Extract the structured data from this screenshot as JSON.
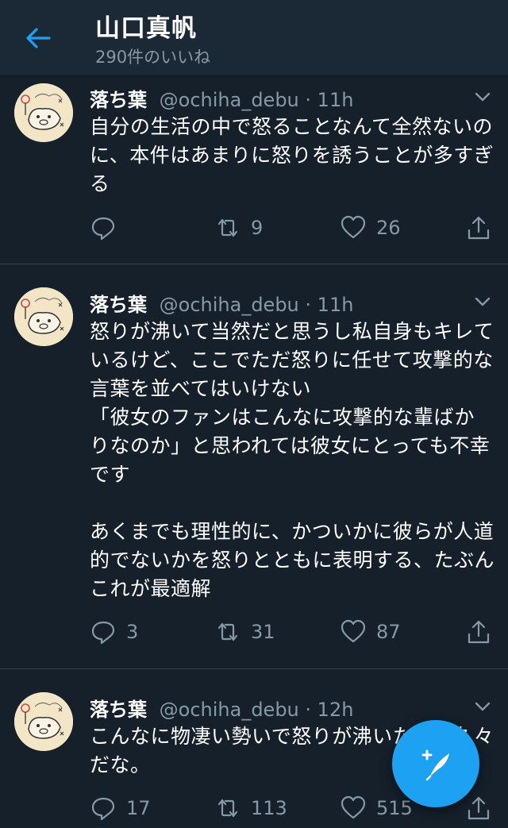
{
  "header": {
    "title": "山口真帆",
    "subtitle": "290件のいいね"
  },
  "colors": {
    "background": "#15202b",
    "header": "#1b2836",
    "secondary_text": "#8899a6",
    "accent": "#1da1f2"
  },
  "tweets": [
    {
      "name": "落ち葉",
      "handle": "@ochiha_debu",
      "time": "11h",
      "text": "自分の生活の中で怒ることなんて全然ないのに、本件はあまりに怒りを誘うことが多すぎる",
      "replies": "",
      "retweets": "9",
      "likes": "26"
    },
    {
      "name": "落ち葉",
      "handle": "@ochiha_debu",
      "time": "11h",
      "text": "怒りが沸いて当然だと思うし私自身もキレているけど、ここでただ怒りに任せて攻撃的な言葉を並べてはいけない\n「彼女のファンはこんなに攻撃的な輩ばかりなのか」と思われては彼女にとっても不幸です\n\nあくまでも理性的に、かついかに彼らが人道的でないかを怒りとともに表明する、たぶんこれが最適解",
      "replies": "3",
      "retweets": "31",
      "likes": "87"
    },
    {
      "name": "落ち葉",
      "handle": "@ochiha_debu",
      "time": "12h",
      "text": "こんなに物凄い勢いで怒りが沸いたのは久々だな。",
      "replies": "17",
      "retweets": "113",
      "likes": "515"
    }
  ],
  "icons": {
    "back": "arrow-left-icon",
    "menu": "chevron-down-icon",
    "reply": "reply-icon",
    "retweet": "retweet-icon",
    "like": "heart-icon",
    "share": "share-icon",
    "compose": "compose-icon"
  }
}
